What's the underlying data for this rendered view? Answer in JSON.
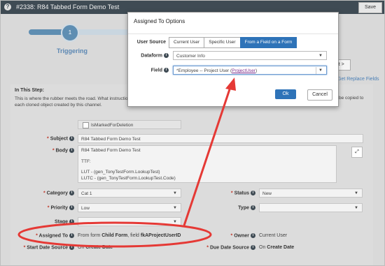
{
  "window": {
    "title": "#2338: R84 Tabbed Form Demo Test",
    "save_label": "Save",
    "help_icon": "?"
  },
  "progress": {
    "step_number": "1",
    "step_label": "Triggering",
    "next_label": "ext >",
    "get_replace_label": "Get Replace Fields"
  },
  "instep": {
    "heading": "In This Step:",
    "description": "This is where the rubber meets the road. What instructions a",
    "description_tail": "be copied to",
    "description_line2": "each cloned object created by this channel."
  },
  "form": {
    "is_marked_label": "IsMarkedForDeletion",
    "subject_label": "Subject",
    "subject_value": "R84 Tabbed Form Demo Test",
    "body_label": "Body",
    "body_lines": [
      "R84 Tabbed Form Demo Test",
      "TTF:",
      "LUT - (gen_TonyTestForm.LookupTest)",
      "LUTC - (gen_TonyTestForm.LookupTest.Code)"
    ],
    "category_label": "Category",
    "category_value": "Cat 1",
    "status_label": "Status",
    "status_value": "New",
    "priority_label": "Priority",
    "priority_value": "Low",
    "type_label": "Type",
    "type_value": "",
    "stage_label": "Stage",
    "stage_value": "",
    "assigned_to_label": "Assigned To",
    "assigned_prefix": "From form",
    "assigned_form": "Child Form",
    "assigned_mid": ", field",
    "assigned_field": "fkAProjectUserID",
    "owner_label": "Owner",
    "owner_value": "Current User",
    "start_date_label": "Start Date Source",
    "start_on": "On",
    "start_value": "Create Date",
    "due_date_label": "Due Date Source",
    "due_on": "On",
    "due_value": "Create Date",
    "required_mark": "*"
  },
  "dialog": {
    "title": "Assigned To Options",
    "user_source_label": "User Source",
    "options": [
      "Current User",
      "Specific User",
      "From a Field on a Form"
    ],
    "active_option": "From a Field on a Form",
    "dataform_label": "Dataform",
    "dataform_value": "Customer Info",
    "field_label": "Field",
    "field_value_prefix": "*Employee -- Project User (",
    "field_value_link": "ProjectUser",
    "field_value_suffix": ")",
    "ok_label": "Ok",
    "cancel_label": "Cancel"
  },
  "colors": {
    "titlebar": "#3f4b54",
    "accent": "#2e73b8",
    "highlight": "#e53935"
  },
  "icons": [
    "info-icon",
    "chevron-down-icon",
    "expand-icon",
    "help-icon"
  ]
}
